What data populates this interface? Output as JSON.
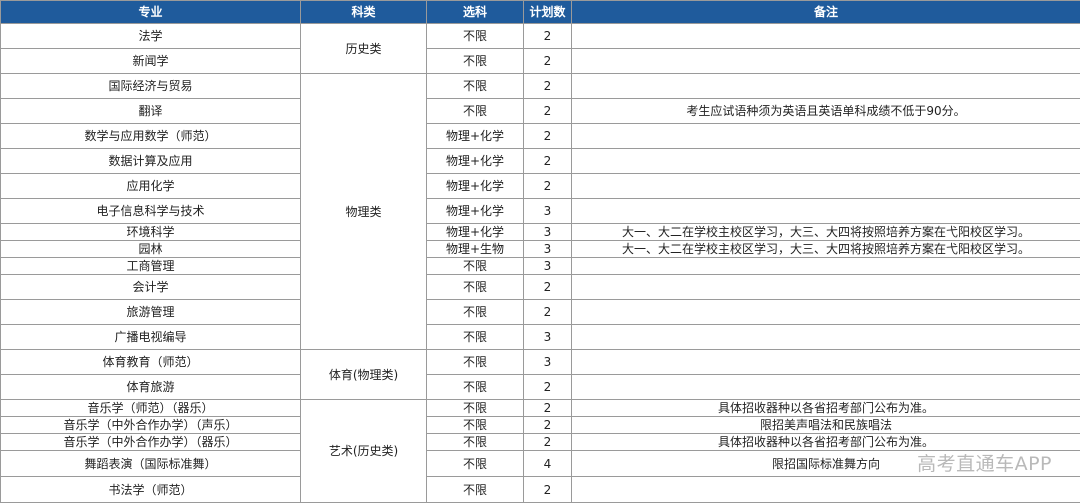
{
  "header": {
    "major": "专业",
    "category": "科类",
    "subjects": "选科",
    "plan_count": "计划数",
    "remarks": "备注"
  },
  "groups": {
    "history": "历史类",
    "physics": "物理类",
    "sports": "体育(物理类)",
    "arts": "艺术(历史类)"
  },
  "rows": [
    {
      "major": "法学",
      "subjects": "不限",
      "count": "2",
      "remark": ""
    },
    {
      "major": "新闻学",
      "subjects": "不限",
      "count": "2",
      "remark": ""
    },
    {
      "major": "国际经济与贸易",
      "subjects": "不限",
      "count": "2",
      "remark": ""
    },
    {
      "major": "翻译",
      "subjects": "不限",
      "count": "2",
      "remark": "考生应试语种须为英语且英语单科成绩不低于90分。"
    },
    {
      "major": "数学与应用数学（师范）",
      "subjects": "物理+化学",
      "count": "2",
      "remark": ""
    },
    {
      "major": "数据计算及应用",
      "subjects": "物理+化学",
      "count": "2",
      "remark": ""
    },
    {
      "major": "应用化学",
      "subjects": "物理+化学",
      "count": "2",
      "remark": ""
    },
    {
      "major": "电子信息科学与技术",
      "subjects": "物理+化学",
      "count": "3",
      "remark": ""
    },
    {
      "major": "环境科学",
      "subjects": "物理+化学",
      "count": "3",
      "remark": "大一、大二在学校主校区学习，大三、大四将按照培养方案在弋阳校区学习。"
    },
    {
      "major": "园林",
      "subjects": "物理+生物",
      "count": "3",
      "remark": "大一、大二在学校主校区学习，大三、大四将按照培养方案在弋阳校区学习。"
    },
    {
      "major": "工商管理",
      "subjects": "不限",
      "count": "3",
      "remark": ""
    },
    {
      "major": "会计学",
      "subjects": "不限",
      "count": "2",
      "remark": ""
    },
    {
      "major": "旅游管理",
      "subjects": "不限",
      "count": "2",
      "remark": ""
    },
    {
      "major": "广播电视编导",
      "subjects": "不限",
      "count": "3",
      "remark": ""
    },
    {
      "major": "体育教育（师范）",
      "subjects": "不限",
      "count": "3",
      "remark": ""
    },
    {
      "major": "体育旅游",
      "subjects": "不限",
      "count": "2",
      "remark": ""
    },
    {
      "major": "音乐学（师范）（器乐）",
      "subjects": "不限",
      "count": "2",
      "remark": "具体招收器种以各省招考部门公布为准。"
    },
    {
      "major": "音乐学（中外合作办学）（声乐）",
      "subjects": "不限",
      "count": "2",
      "remark": "限招美声唱法和民族唱法"
    },
    {
      "major": "音乐学（中外合作办学）（器乐）",
      "subjects": "不限",
      "count": "2",
      "remark": "具体招收器种以各省招考部门公布为准。"
    },
    {
      "major": "舞蹈表演（国际标准舞）",
      "subjects": "不限",
      "count": "4",
      "remark": "限招国际标准舞方向"
    },
    {
      "major": "书法学（师范）",
      "subjects": "不限",
      "count": "2",
      "remark": ""
    }
  ],
  "watermark": "高考直通车APP"
}
